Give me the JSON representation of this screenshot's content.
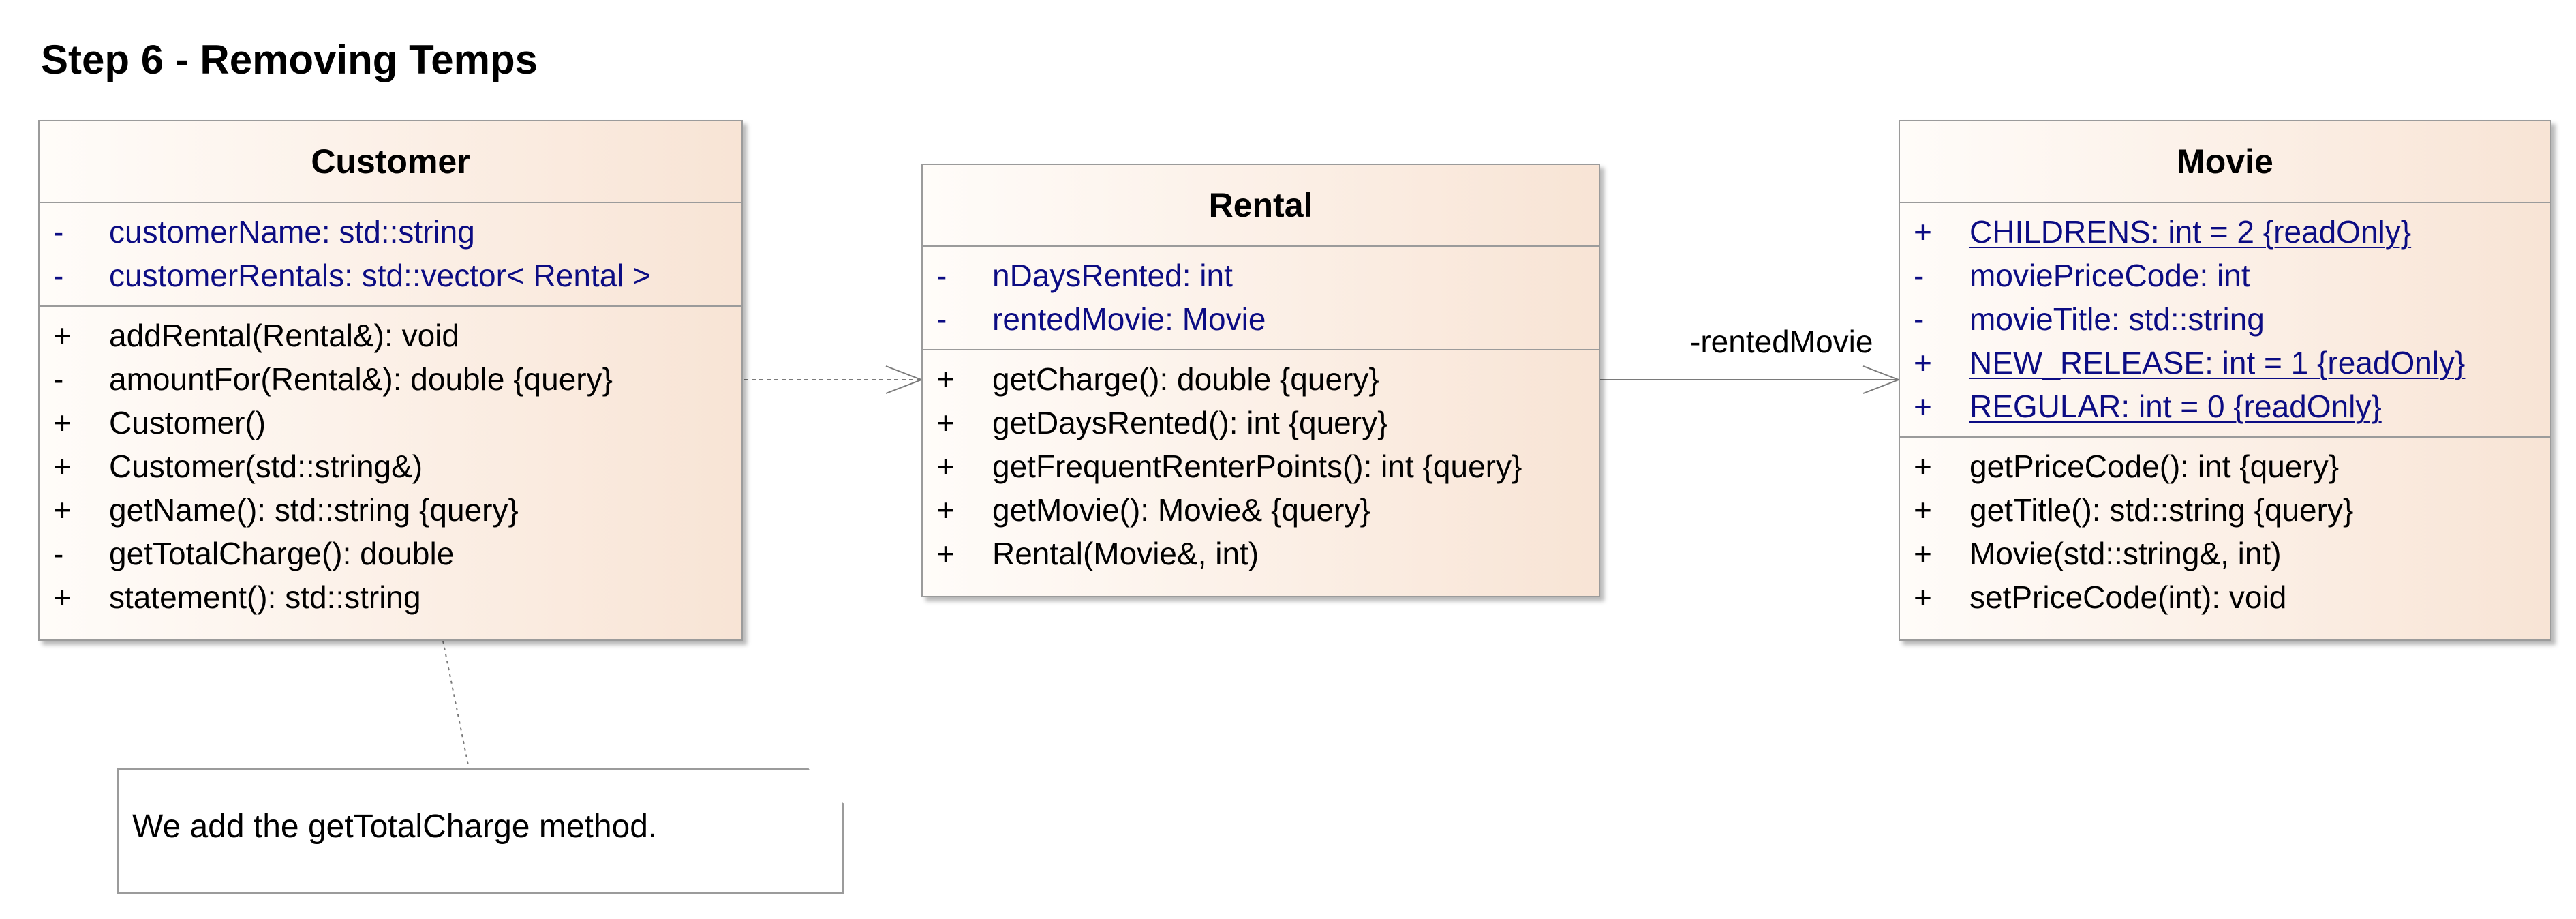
{
  "diagram": {
    "title": "Step 6 - Removing Temps"
  },
  "classes": {
    "customer": {
      "name": "Customer",
      "attributes": [
        {
          "vis": "-",
          "text": "customerName: std::string"
        },
        {
          "vis": "-",
          "text": "customerRentals: std::vector< Rental >"
        }
      ],
      "operations": [
        {
          "vis": "+",
          "text": "addRental(Rental&): void"
        },
        {
          "vis": "-",
          "text": "amountFor(Rental&): double {query}"
        },
        {
          "vis": "+",
          "text": "Customer()"
        },
        {
          "vis": "+",
          "text": "Customer(std::string&)"
        },
        {
          "vis": "+",
          "text": "getName(): std::string {query}"
        },
        {
          "vis": "-",
          "text": "getTotalCharge(): double"
        },
        {
          "vis": "+",
          "text": "statement(): std::string"
        }
      ]
    },
    "rental": {
      "name": "Rental",
      "attributes": [
        {
          "vis": "-",
          "text": "nDaysRented: int"
        },
        {
          "vis": "-",
          "text": "rentedMovie: Movie"
        }
      ],
      "operations": [
        {
          "vis": "+",
          "text": "getCharge(): double {query}"
        },
        {
          "vis": "+",
          "text": "getDaysRented(): int {query}"
        },
        {
          "vis": "+",
          "text": "getFrequentRenterPoints(): int {query}"
        },
        {
          "vis": "+",
          "text": "getMovie(): Movie& {query}"
        },
        {
          "vis": "+",
          "text": "Rental(Movie&, int)"
        }
      ]
    },
    "movie": {
      "name": "Movie",
      "attributes": [
        {
          "vis": "+",
          "text": "CHILDRENS: int = 2 {readOnly}"
        },
        {
          "vis": "-",
          "text": "moviePriceCode: int"
        },
        {
          "vis": "-",
          "text": "movieTitle: std::string"
        },
        {
          "vis": "+",
          "text": "NEW_RELEASE: int = 1 {readOnly}"
        },
        {
          "vis": "+",
          "text": "REGULAR: int = 0 {readOnly}"
        }
      ],
      "operations": [
        {
          "vis": "+",
          "text": "getPriceCode(): int {query}"
        },
        {
          "vis": "+",
          "text": "getTitle(): std::string {query}"
        },
        {
          "vis": "+",
          "text": "Movie(std::string&, int)"
        },
        {
          "vis": "+",
          "text": "setPriceCode(int): void"
        }
      ]
    }
  },
  "relations": {
    "rental_to_movie": {
      "role": "-rentedMovie"
    }
  },
  "note": {
    "text": "We add the getTotalCharge method."
  },
  "colors": {
    "attribute_text": "#0c0c83",
    "class_fill_start": "#fffcf9",
    "class_fill_end": "#f8e4d5",
    "border": "#9b9b9b"
  }
}
